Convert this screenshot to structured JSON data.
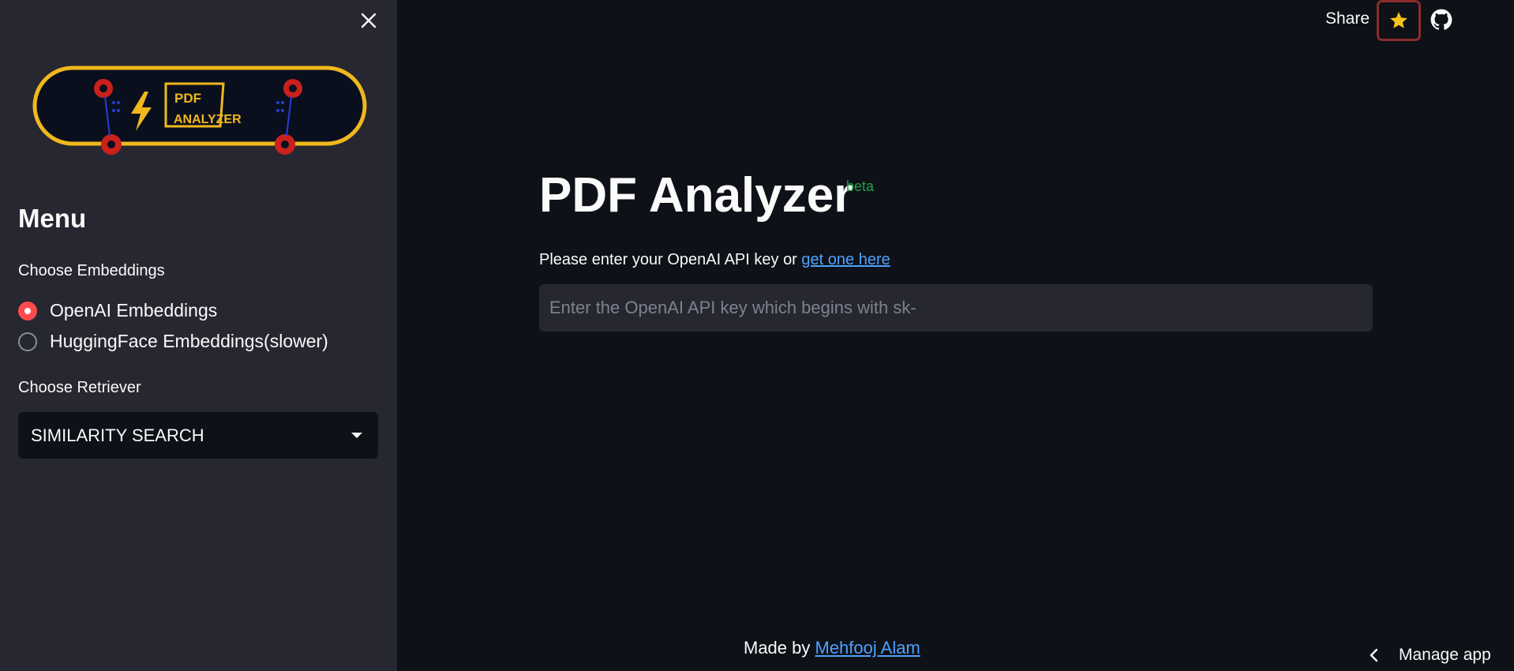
{
  "sidebar": {
    "menu_title": "Menu",
    "embeddings_label": "Choose Embeddings",
    "embedding_options": [
      {
        "label": "OpenAI Embeddings",
        "selected": true
      },
      {
        "label": "HuggingFace Embeddings(slower)",
        "selected": false
      }
    ],
    "retriever_label": "Choose Retriever",
    "retriever_selected": "SIMILARITY SEARCH",
    "logo_line1": "PDF",
    "logo_line2": "ANALYZER"
  },
  "header": {
    "share_label": "Share"
  },
  "main": {
    "title": "PDF Analyzer",
    "badge": "beta",
    "prompt_text": "Please enter your OpenAI API key or ",
    "prompt_link": "get one here",
    "api_placeholder": "Enter the OpenAI API key which begins with sk-"
  },
  "footer": {
    "made_by": "Made by ",
    "author": "Mehfooj Alam",
    "manage_label": "Manage app"
  },
  "colors": {
    "accent": "#ff4b4b",
    "link": "#4ea1ff",
    "beta": "#21a14a",
    "sidebar_bg": "#262730",
    "main_bg": "#0e1117"
  }
}
